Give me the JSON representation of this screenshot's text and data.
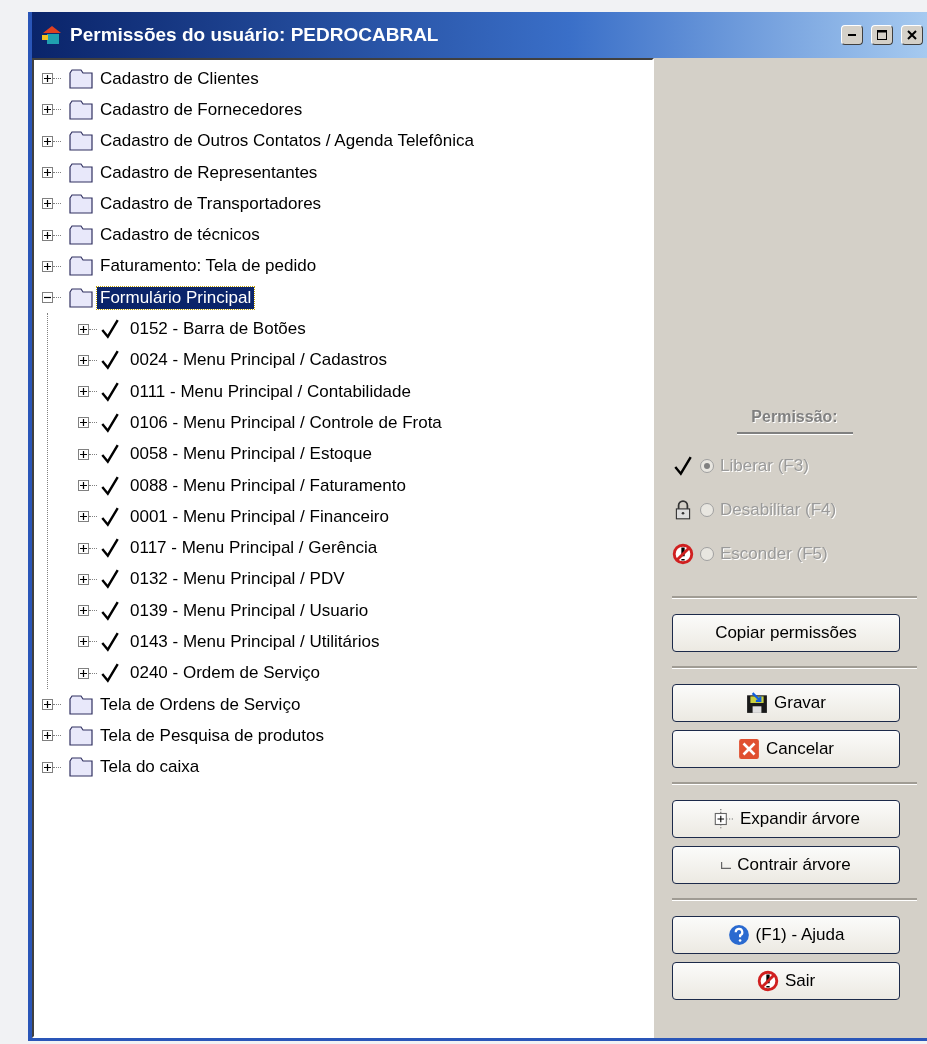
{
  "window": {
    "title": "Permissões do usuário: PEDROCABRAL"
  },
  "tree": [
    {
      "label": "Cadastro de Clientes",
      "kind": "folder",
      "expanded": false,
      "selected": false
    },
    {
      "label": "Cadastro de Fornecedores",
      "kind": "folder",
      "expanded": false,
      "selected": false
    },
    {
      "label": "Cadastro de Outros Contatos / Agenda Telefônica",
      "kind": "folder",
      "expanded": false,
      "selected": false
    },
    {
      "label": "Cadastro de Representantes",
      "kind": "folder",
      "expanded": false,
      "selected": false
    },
    {
      "label": "Cadastro de Transportadores",
      "kind": "folder",
      "expanded": false,
      "selected": false
    },
    {
      "label": "Cadastro de técnicos",
      "kind": "folder",
      "expanded": false,
      "selected": false
    },
    {
      "label": "Faturamento: Tela de pedido",
      "kind": "folder",
      "expanded": false,
      "selected": false
    },
    {
      "label": "Formulário Principal",
      "kind": "folder",
      "expanded": true,
      "selected": true,
      "children": [
        {
          "label": "0152 - Barra de Botões",
          "kind": "check",
          "expanded": false,
          "selected": false
        },
        {
          "label": "0024 - Menu Principal / Cadastros",
          "kind": "check",
          "expanded": false,
          "selected": false
        },
        {
          "label": "0111 - Menu Principal / Contabilidade",
          "kind": "check",
          "expanded": false,
          "selected": false
        },
        {
          "label": "0106 - Menu Principal / Controle de Frota",
          "kind": "check",
          "expanded": false,
          "selected": false
        },
        {
          "label": "0058 - Menu Principal / Estoque",
          "kind": "check",
          "expanded": false,
          "selected": false
        },
        {
          "label": "0088 - Menu Principal / Faturamento",
          "kind": "check",
          "expanded": false,
          "selected": false
        },
        {
          "label": "0001 - Menu Principal / Financeiro",
          "kind": "check",
          "expanded": false,
          "selected": false
        },
        {
          "label": "0117 - Menu Principal / Gerência",
          "kind": "check",
          "expanded": false,
          "selected": false
        },
        {
          "label": "0132 - Menu Principal / PDV",
          "kind": "check",
          "expanded": false,
          "selected": false
        },
        {
          "label": "0139 - Menu Principal / Usuario",
          "kind": "check",
          "expanded": false,
          "selected": false
        },
        {
          "label": "0143 - Menu Principal / Utilitários",
          "kind": "check",
          "expanded": false,
          "selected": false
        },
        {
          "label": "0240 - Ordem de Serviço",
          "kind": "check",
          "expanded": false,
          "selected": false
        }
      ]
    },
    {
      "label": "Tela de Ordens de Serviço",
      "kind": "folder",
      "expanded": false,
      "selected": false
    },
    {
      "label": "Tela de Pesquisa de produtos",
      "kind": "folder",
      "expanded": false,
      "selected": false
    },
    {
      "label": "Tela do caixa",
      "kind": "folder",
      "expanded": false,
      "selected": false
    }
  ],
  "permission": {
    "title": "Permissão:",
    "disabled": true,
    "options": [
      {
        "label": "Liberar (F3)",
        "kind": "allow",
        "selected": true
      },
      {
        "label": "Desabilitar (F4)",
        "kind": "lock",
        "selected": false
      },
      {
        "label": "Esconder (F5)",
        "kind": "hide",
        "selected": false
      }
    ]
  },
  "button_groups": [
    [
      {
        "label": "Copiar permissões",
        "kind": "plain"
      }
    ],
    [
      {
        "label": "Gravar",
        "kind": "save"
      },
      {
        "label": "Cancelar",
        "kind": "cancel"
      }
    ],
    [
      {
        "label": "Expandir árvore",
        "kind": "expand"
      },
      {
        "label": "Contrair árvore",
        "kind": "collapse"
      }
    ],
    [
      {
        "label": "(F1) - Ajuda",
        "kind": "help"
      },
      {
        "label": "Sair",
        "kind": "exit"
      }
    ]
  ]
}
